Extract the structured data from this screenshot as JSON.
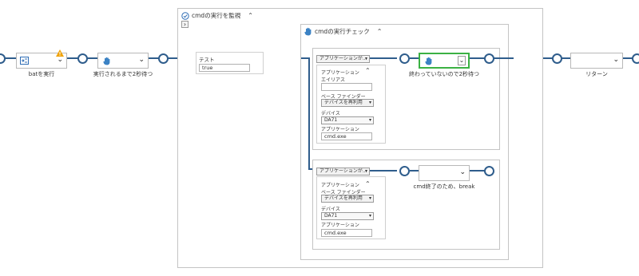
{
  "activities": {
    "bat": {
      "label": "batを実行",
      "warning": "warning-icon"
    },
    "wait1": {
      "label": "実行されるまで2秒待つ"
    },
    "test": {
      "label": "テスト",
      "value": "true"
    },
    "wait2": {
      "label": "終わっていないので2秒待つ"
    },
    "cmd_break": {
      "label": "cmd終了のため、break"
    },
    "return": {
      "label": "リターン"
    }
  },
  "monitor": {
    "title": "cmdの実行を監視",
    "expand_glyph": "⌃",
    "nav_glyph": "›"
  },
  "check": {
    "title": "cmdの実行チェック",
    "expand_glyph": "⌃"
  },
  "branch1": {
    "condition": "アプリケーションが...",
    "app_label": "アプリケーション",
    "alias_label": "エイリアス",
    "alias_value": "",
    "base_finder_label": "ベース ファインダー",
    "base_finder_value": "デバイスを再利用",
    "device_label": "デバイス",
    "device_value": "DA71",
    "app_name_label": "アプリケーション",
    "app_name_value": "cmd.exe"
  },
  "branch2": {
    "condition": "アプリケーションが...",
    "app_label": "アプリケーション",
    "base_finder_label": "ベース ファインダー",
    "base_finder_value": "デバイスを再利用",
    "device_label": "デバイス",
    "device_value": "DA71",
    "app_name_label": "アプリケーション",
    "app_name_value": "cmd.exe"
  },
  "colors": {
    "flow": "#2f5d8c",
    "selected": "#3bb143",
    "warning": "#f0a30a",
    "panel_border": "#c4c4c4"
  }
}
